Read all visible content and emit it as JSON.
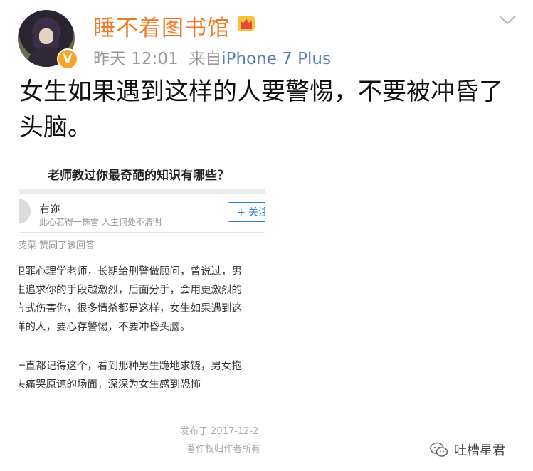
{
  "header": {
    "username": "睡不着图书馆",
    "verified_badge": "V",
    "crown_icon": "crown-icon",
    "timestamp": "昨天 12:01",
    "source_prefix": "来自",
    "source_device": "iPhone 7 Plus"
  },
  "post": {
    "text": "女生如果遇到这样的人要警惕，不要被冲昏了头脑。"
  },
  "screenshot": {
    "question_title": "老师教过你最奇葩的知识有哪些？",
    "answerer_name": "右迩",
    "answerer_bio": "此心若得一株雪 人生何处不清明",
    "follow_label": "+ 关注",
    "liked_text": "芰菜 赞同了该回答",
    "paragraph1": [
      "卫罪心理学老师，长期给刑警做顾问，曾说过，男",
      "生追求你的手段越激烈，后面分手，会用更激烈的",
      "方式伤害你，很多情杀都是这样，女生如果遇到这",
      "样的人，要心存警惕，不要冲昏头脑。"
    ],
    "paragraph2": [
      "一直都记得这个，看到那种男生跪地求饶，男女抱",
      "头痛哭原谅的场面，深深为女生感到恐怖"
    ],
    "published": "发布于 2017-12-2",
    "copyright": "著作权归作者所有"
  },
  "watermark": {
    "text": "吐槽星君",
    "icon": "wechat-icon"
  },
  "colors": {
    "username": "#f07a28",
    "source_link": "#5a80b5",
    "follow_button": "#2a7ee0",
    "verified_badge": "#f5a623"
  }
}
